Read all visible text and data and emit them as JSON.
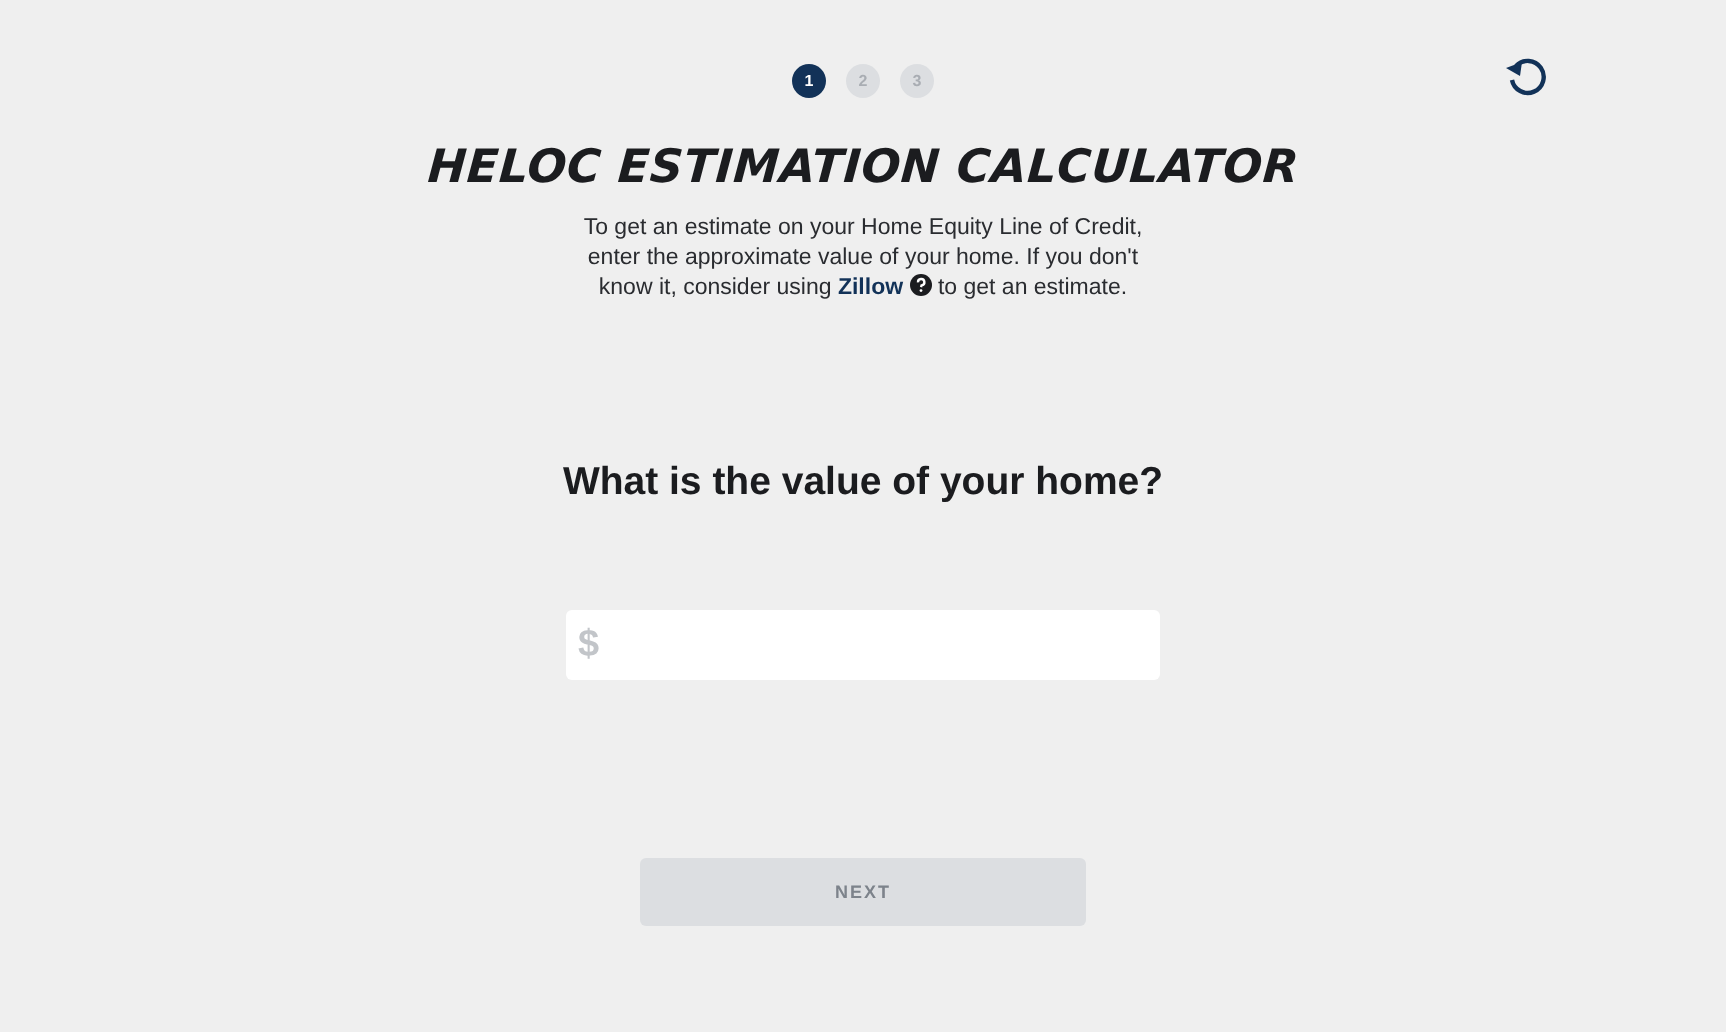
{
  "steps": [
    {
      "label": "1",
      "selected": true
    },
    {
      "label": "2",
      "selected": false
    },
    {
      "label": "3",
      "selected": false
    }
  ],
  "title": "HELOC ESTIMATION CALCULATOR",
  "intro": {
    "before": "To get an estimate on your Home Equity Line of Credit, enter the approximate value of your home. If you don't know it, consider using",
    "link": "Zillow",
    "after": "to get an estimate."
  },
  "question": "What is the value of your home?",
  "value_field": {
    "prefix": "$"
  },
  "next_button": {
    "label": "NEXT",
    "disabled": true
  }
}
